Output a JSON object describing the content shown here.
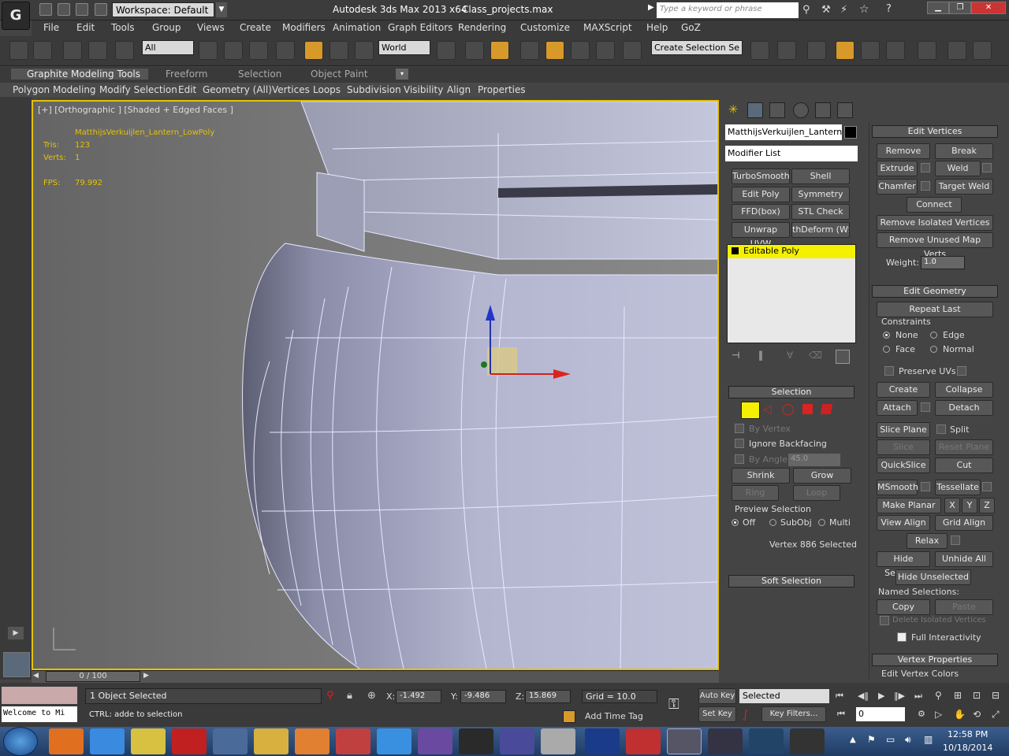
{
  "title": {
    "workspace": "Workspace: Default",
    "app": "Autodesk 3ds Max  2013 x64",
    "file": "Class_projects.max",
    "search_placeholder": "Type a keyword or phrase"
  },
  "menu": [
    "File",
    "Edit",
    "Tools",
    "Group",
    "Views",
    "Create",
    "Modifiers",
    "Animation",
    "Graph Editors",
    "Rendering",
    "Customize",
    "MAXScript",
    "Help",
    "GoZ"
  ],
  "toolbar": {
    "filter": "All",
    "coord": "World",
    "selset": "Create Selection Se"
  },
  "ribbon": {
    "tabs": [
      "Graphite Modeling Tools",
      "Freeform",
      "Selection",
      "Object Paint"
    ],
    "subtabs": [
      "Polygon Modeling",
      "Modify Selection",
      "Edit",
      "Geometry (All)",
      "Vertices",
      "Loops",
      "Subdivision",
      "Visibility",
      "Align",
      "Properties"
    ]
  },
  "viewport": {
    "label": "[+] [Orthographic ] [Shaded + Edged Faces ]",
    "object": "MatthijsVerkuijlen_Lantern_LowPoly",
    "tris_label": "Tris:",
    "tris": "123",
    "verts_label": "Verts:",
    "verts": "1",
    "fps_label": "FPS:",
    "fps": "79.992"
  },
  "modifier": {
    "name": "MatthijsVerkuijlen_Lantern_Lo",
    "list": "Modifier List",
    "buttons": [
      "TurboSmooth",
      "Shell",
      "Edit Poly",
      "Symmetry",
      "FFD(box)",
      "STL Check",
      "Unwrap UVW",
      "thDeform (WSI"
    ],
    "stack_item": "Editable Poly"
  },
  "selection": {
    "header": "Selection",
    "by_vertex": "By Vertex",
    "ignore_backfacing": "Ignore Backfacing",
    "by_angle": "By Angle:",
    "angle": "45.0",
    "shrink": "Shrink",
    "grow": "Grow",
    "ring": "Ring",
    "loop": "Loop",
    "preview": "Preview Selection",
    "off": "Off",
    "subobj": "SubObj",
    "multi": "Multi",
    "status": "Vertex 886 Selected",
    "soft": "Soft Selection"
  },
  "edit_vertices": {
    "header": "Edit Vertices",
    "remove": "Remove",
    "break": "Break",
    "extrude": "Extrude",
    "weld": "Weld",
    "chamfer": "Chamfer",
    "target_weld": "Target Weld",
    "connect": "Connect",
    "remove_isolated": "Remove Isolated Vertices",
    "remove_unused": "Remove Unused Map Verts",
    "weight_label": "Weight:",
    "weight": "1.0"
  },
  "edit_geometry": {
    "header": "Edit Geometry",
    "repeat": "Repeat Last",
    "constraints": "Constraints",
    "none": "None",
    "edge": "Edge",
    "face": "Face",
    "normal": "Normal",
    "preserve": "Preserve UVs",
    "create": "Create",
    "collapse": "Collapse",
    "attach": "Attach",
    "detach": "Detach",
    "slice_plane": "Slice Plane",
    "split": "Split",
    "slice": "Slice",
    "reset_plane": "Reset Plane",
    "quickslice": "QuickSlice",
    "cut": "Cut",
    "msmooth": "MSmooth",
    "tessellate": "Tessellate",
    "make_planar": "Make Planar",
    "x": "X",
    "y": "Y",
    "z": "Z",
    "view_align": "View Align",
    "grid_align": "Grid Align",
    "relax": "Relax",
    "hide_selected": "Hide Selected",
    "unhide_all": "Unhide All",
    "hide_unselected": "Hide Unselected",
    "named": "Named Selections:",
    "copy": "Copy",
    "paste": "Paste",
    "delete_isolated": "Delete Isolated Vertices",
    "full_interactivity": "Full Interactivity",
    "vertex_props": "Vertex Properties",
    "edit_colors": "Edit Vertex Colors"
  },
  "timeline": {
    "frame": "0 / 100"
  },
  "status": {
    "selected": "1 Object Selected",
    "prompt": "CTRL: adde to selection",
    "listener": "Welcome to Mi",
    "x_label": "X:",
    "x": "-1.492",
    "y_label": "Y:",
    "y": "-9.486",
    "z_label": "Z:",
    "z": "15.869",
    "grid": "Grid = 10.0",
    "add_time_tag": "Add Time Tag",
    "auto_key": "Auto Key",
    "set_key": "Set Key",
    "key_mode": "Selected",
    "key_filters": "Key Filters...",
    "frame_field": "0"
  },
  "taskbar": {
    "time": "12:58 PM",
    "date": "10/18/2014"
  }
}
